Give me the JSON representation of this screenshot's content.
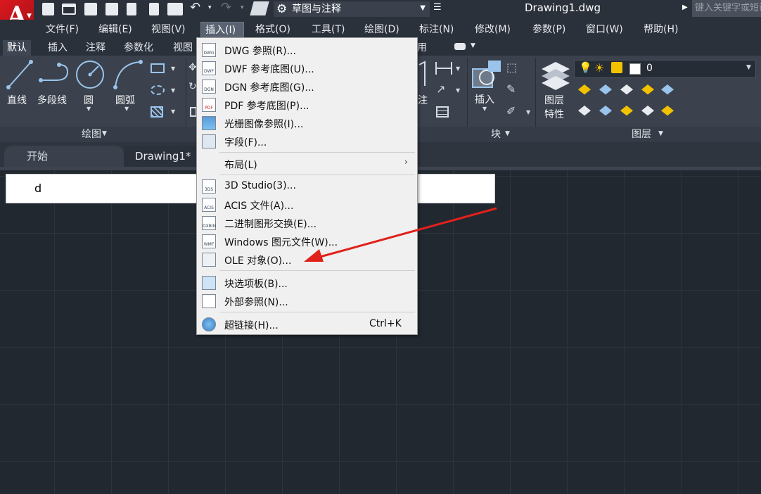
{
  "app": {
    "logo_letter": "A",
    "workspace": "草图与注释",
    "document_title": "Drawing1.dwg",
    "search_placeholder": "键入关键字或短语"
  },
  "menubar": {
    "items": [
      "文件(F)",
      "编辑(E)",
      "视图(V)",
      "插入(I)",
      "格式(O)",
      "工具(T)",
      "绘图(D)",
      "标注(N)",
      "修改(M)",
      "参数(P)",
      "窗口(W)",
      "帮助(H)"
    ],
    "active": "插入(I)"
  },
  "ribbon_tabs": [
    "默认",
    "插入",
    "注释",
    "参数化",
    "视图",
    "用"
  ],
  "ribbon": {
    "draw_tools": [
      "直线",
      "多段线",
      "圆",
      "圆弧"
    ],
    "draw_panel_title": "绘图",
    "annot_partial": "注",
    "block_tool": "插入",
    "block_panel_title": "块",
    "layer_tool_line1": "图层",
    "layer_tool_line2": "特性",
    "layer_name": "0",
    "layer_panel_title": "图层"
  },
  "doc_tabs": {
    "start": "开始",
    "drawing": "Drawing1*"
  },
  "command_text": "d",
  "insert_menu": {
    "items": [
      {
        "label": "DWG 参照(R)...",
        "icon": "dwg-icon",
        "icon_text": "DWG"
      },
      {
        "label": "DWF 参考底图(U)...",
        "icon": "dwf-icon",
        "icon_text": "DWF"
      },
      {
        "label": "DGN 参考底图(G)...",
        "icon": "dgn-icon",
        "icon_text": "DGN"
      },
      {
        "label": "PDF 参考底图(P)...",
        "icon": "pdf-icon",
        "icon_text": "PDF"
      },
      {
        "label": "光栅图像参照(I)...",
        "icon": "raster-image-icon",
        "icon_text": ""
      },
      {
        "label": "字段(F)...",
        "icon": "field-icon",
        "icon_text": ""
      },
      {
        "label": "布局(L)",
        "icon": "",
        "icon_text": ""
      },
      {
        "label": "3D Studio(3)...",
        "icon": "3ds-icon",
        "icon_text": "3DS"
      },
      {
        "label": "ACIS 文件(A)...",
        "icon": "acis-icon",
        "icon_text": "ACIS"
      },
      {
        "label": "二进制图形交换(E)...",
        "icon": "dxbin-icon",
        "icon_text": "DXBIN"
      },
      {
        "label": "Windows 图元文件(W)...",
        "icon": "wmf-icon",
        "icon_text": "WMF"
      },
      {
        "label": "OLE 对象(O)...",
        "icon": "ole-icon",
        "icon_text": ""
      },
      {
        "label": "块选项板(B)...",
        "icon": "block-palette-icon",
        "icon_text": ""
      },
      {
        "label": "外部参照(N)...",
        "icon": "xref-icon",
        "icon_text": ""
      },
      {
        "label": "超链接(H)...",
        "icon": "hyperlink-icon",
        "icon_text": ""
      }
    ],
    "hyperlink_shortcut": "Ctrl+K"
  },
  "colors": {
    "accent_red": "#e0211b",
    "logo_red": "#c8171e",
    "menu_bg": "#f0f0f0",
    "canvas_bg": "#212830"
  }
}
